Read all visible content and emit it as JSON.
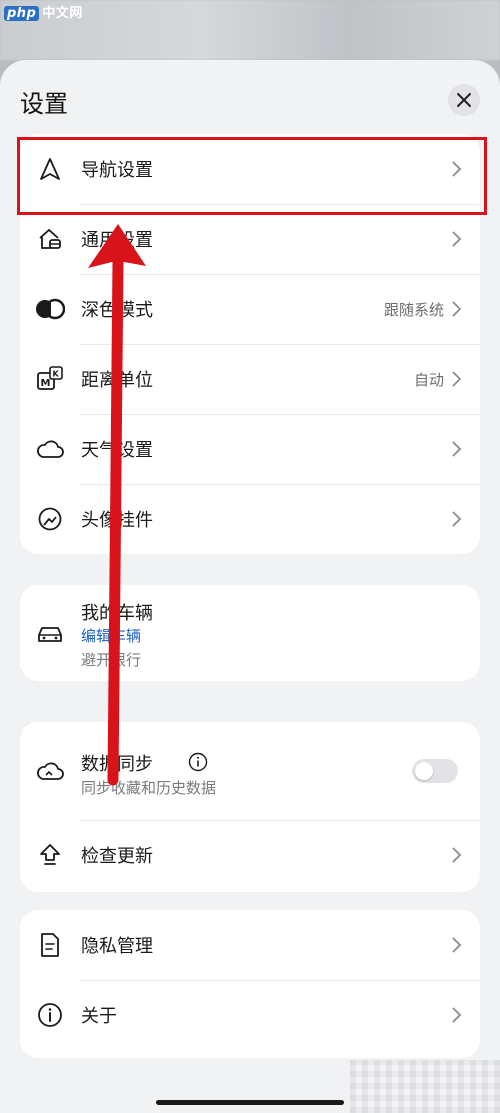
{
  "watermark": {
    "php": "php",
    "site": "中文网"
  },
  "sheet": {
    "title": "设置"
  },
  "card1": {
    "items": [
      {
        "label": "导航设置",
        "value": ""
      },
      {
        "label": "通用设置",
        "value": ""
      },
      {
        "label": "深色模式",
        "value": "跟随系统"
      },
      {
        "label": "距离单位",
        "value": "自动"
      },
      {
        "label": "天气设置",
        "value": ""
      },
      {
        "label": "头像挂件",
        "value": ""
      }
    ]
  },
  "vehicle": {
    "title": "我的车辆",
    "edit": "编辑车辆",
    "note": "避开限行"
  },
  "card3": {
    "sync_title": "数据同步",
    "sync_sub": "同步收藏和历史数据",
    "sync_enabled": false,
    "update": "检查更新"
  },
  "card4": {
    "privacy": "隐私管理",
    "about": "关于"
  },
  "colors": {
    "highlight": "#d8141a",
    "link": "#1b61c9"
  }
}
